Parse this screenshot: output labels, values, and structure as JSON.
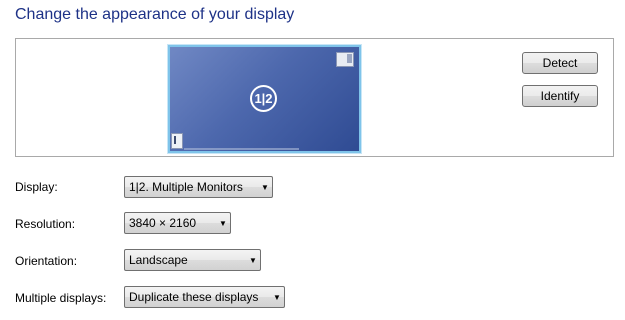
{
  "page": {
    "title": "Change the appearance of your display"
  },
  "preview": {
    "monitor_label": "1|2",
    "detect_label": "Detect",
    "identify_label": "Identify"
  },
  "settings": {
    "display": {
      "label": "Display:",
      "value": "1|2. Multiple Monitors"
    },
    "resolution": {
      "label": "Resolution:",
      "value": "3840 × 2160"
    },
    "orientation": {
      "label": "Orientation:",
      "value": "Landscape"
    },
    "multiple_displays": {
      "label": "Multiple displays:",
      "value": "Duplicate these displays"
    }
  },
  "icons": {
    "dropdown_arrow": "chevron-down-icon",
    "monitor_mini": "monitor-icon",
    "corner": "taskbar-icon"
  },
  "colors": {
    "title": "#1e3287",
    "monitor_border": "#7fc4ea",
    "monitor_fill": "#4d68ad"
  }
}
